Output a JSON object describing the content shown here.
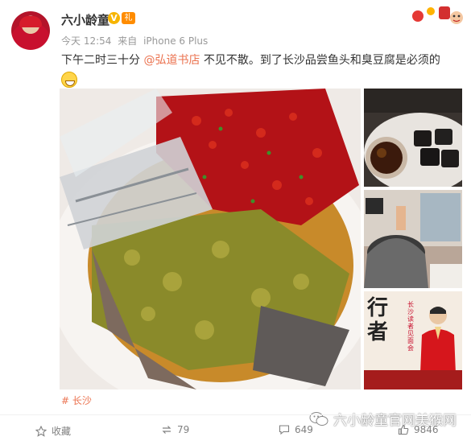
{
  "post": {
    "user": {
      "name": "六小龄童",
      "verified_badge": "V",
      "gift_badge": "礼"
    },
    "meta": {
      "time": "今天 12:54",
      "source_prefix": "来自",
      "device": "iPhone 6 Plus"
    },
    "text": {
      "part1": "下午二时三十分 ",
      "mention": "@弘道书店",
      "part2": " 不见不散。到了长沙品尝鱼头和臭豆腐是必须的"
    },
    "images": {
      "main": "fish-head-dish",
      "thumbs": [
        "stinky-tofu",
        "hotel-room",
        "book-signing-poster"
      ]
    },
    "poster": {
      "title": "行者",
      "subtitle": "长沙读者见面会"
    },
    "topic": "# 长沙",
    "actions": {
      "favorite_label": "收藏",
      "repost_count": "79",
      "comment_count": "649",
      "like_count": "9846"
    },
    "watermark": "六小龄童官网美猴网",
    "colors": {
      "link": "#eb7350",
      "muted": "#999999",
      "action": "#808080",
      "verified": "#f7b500"
    }
  }
}
